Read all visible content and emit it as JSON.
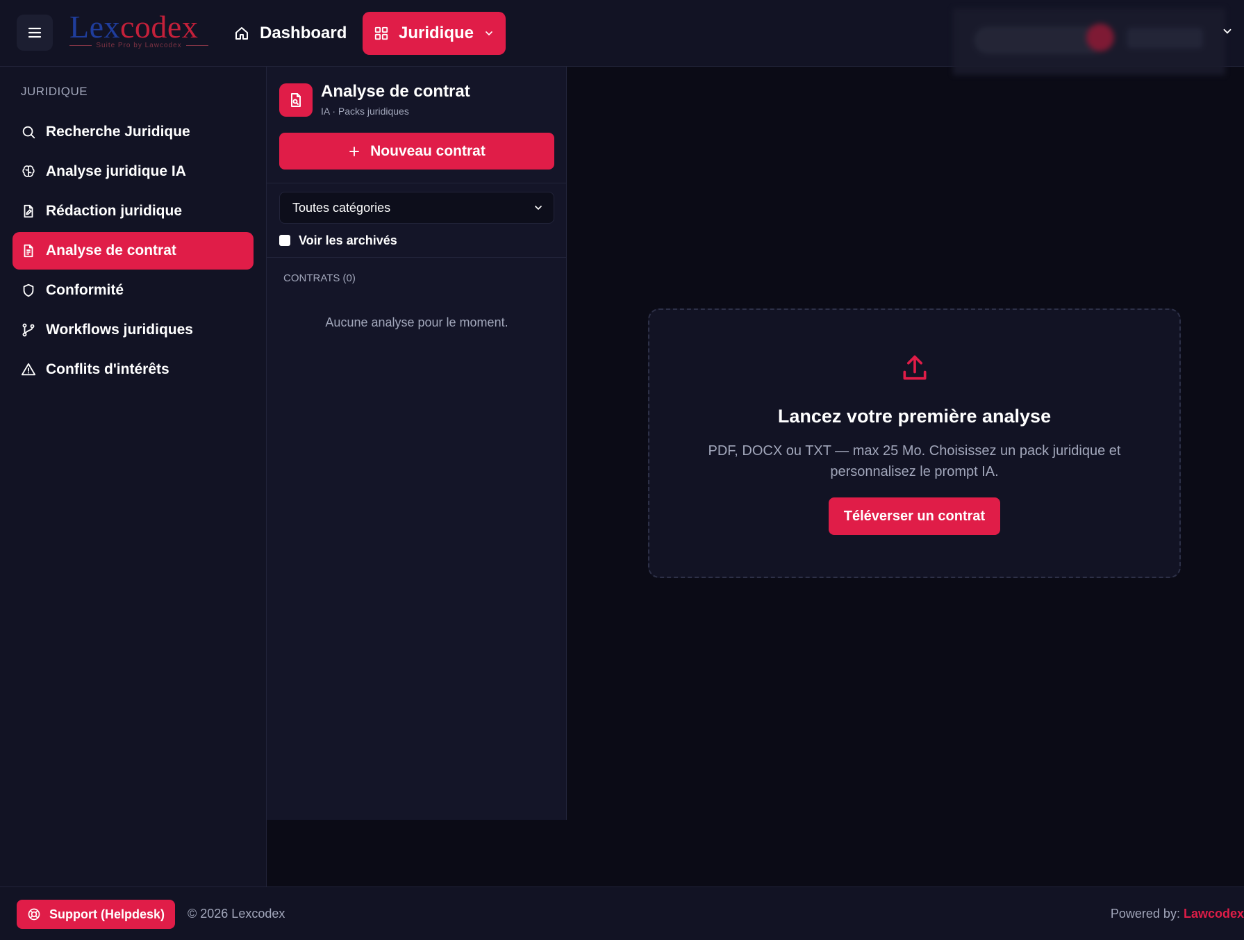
{
  "header": {
    "logo_main_1": "Lex",
    "logo_main_2": "codex",
    "logo_sub": "Suite Pro by Lawcodex",
    "nav_dashboard": "Dashboard",
    "nav_juridique": "Juridique"
  },
  "sidebar": {
    "title": "JURIDIQUE",
    "items": [
      {
        "label": "Recherche Juridique",
        "icon": "search-icon"
      },
      {
        "label": "Analyse juridique IA",
        "icon": "brain-icon"
      },
      {
        "label": "Rédaction juridique",
        "icon": "document-edit-icon"
      },
      {
        "label": "Analyse de contrat",
        "icon": "document-text-icon",
        "active": true
      },
      {
        "label": "Conformité",
        "icon": "shield-icon"
      },
      {
        "label": "Workflows juridiques",
        "icon": "branch-icon"
      },
      {
        "label": "Conflits d'intérêts",
        "icon": "warning-icon"
      }
    ]
  },
  "panel": {
    "title": "Analyse de contrat",
    "subtitle": "IA · Packs juridiques",
    "new_button": "Nouveau contrat",
    "category_select": "Toutes catégories",
    "archive_label": "Voir les archivés",
    "archive_checked": false,
    "contracts_label": "CONTRATS (0)",
    "empty_message": "Aucune analyse pour le moment."
  },
  "upload": {
    "title": "Lancez votre première analyse",
    "description": "PDF, DOCX ou TXT — max 25 Mo. Choisissez un pack juridique et personnalisez le prompt IA.",
    "button": "Téléverser un contrat"
  },
  "footer": {
    "support_button": "Support (Helpdesk)",
    "copyright": "© 2026 Lexcodex",
    "powered_prefix": "Powered by:",
    "powered_brand": "Lawcodex"
  },
  "colors": {
    "accent": "#e01d48",
    "background": "#0b0b16",
    "surface": "#121324",
    "muted_text": "#a2a7bb"
  }
}
